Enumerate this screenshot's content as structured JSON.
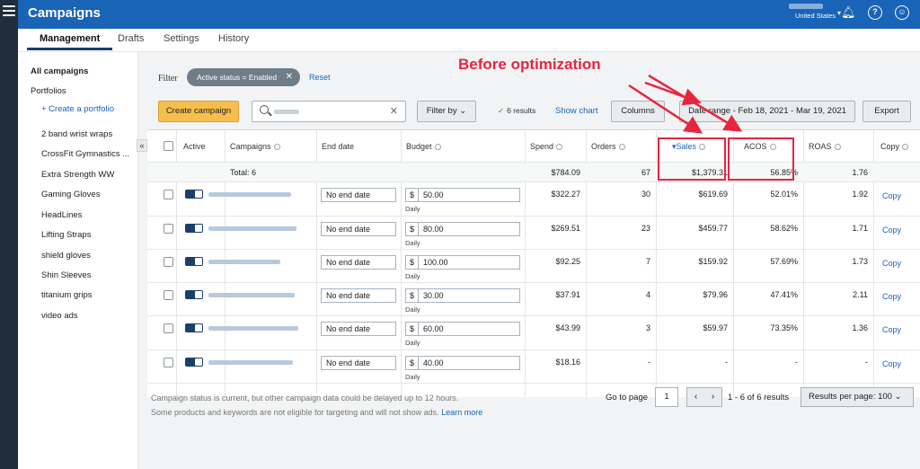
{
  "header": {
    "title": "Campaigns",
    "country": "United States",
    "bell_icon": "bell-icon",
    "help_icon": "help-icon",
    "user_icon": "user-icon"
  },
  "subnav": [
    "Management",
    "Drafts",
    "Settings",
    "History"
  ],
  "sidebar": {
    "all_campaigns": "All campaigns",
    "portfolios": "Portfolios",
    "create_portfolio": "+ Create a portfolio",
    "items": [
      "2 band wrist wraps",
      "CrossFit Gymnastics ...",
      "Extra Strength WW",
      "Gaming Gloves",
      "HeadLines",
      "Lifting Straps",
      "shield gloves",
      "Shin Sleeves",
      "titanium grips",
      "video ads"
    ]
  },
  "filter": {
    "label": "Filter",
    "chip": "Active status = Enabled",
    "reset": "Reset"
  },
  "annotation": "Before optimization",
  "toolbar": {
    "create": "Create campaign",
    "filter_by": "Filter by",
    "results": "6 results",
    "show_chart": "Show chart",
    "columns": "Columns",
    "date_range": "Date range - Feb 18, 2021 - Mar 19, 2021",
    "export": "Export"
  },
  "table": {
    "headers": {
      "active": "Active",
      "campaigns": "Campaigns",
      "end_date": "End date",
      "budget": "Budget",
      "spend": "Spend",
      "orders": "Orders",
      "sales": "Sales",
      "acos": "ACOS",
      "roas": "ROAS",
      "copy": "Copy"
    },
    "total": {
      "label": "Total: 6",
      "spend": "$784.09",
      "orders": "67",
      "sales": "$1,379.31",
      "acos": "56.85%",
      "roas": "1.76"
    },
    "rows": [
      {
        "end_date": "No end date",
        "budget": "50.00",
        "daily": "Daily",
        "spend": "$322.27",
        "orders": "30",
        "sales": "$619.69",
        "acos": "52.01%",
        "roas": "1.92",
        "copy": "Copy"
      },
      {
        "end_date": "No end date",
        "budget": "80.00",
        "daily": "Daily",
        "spend": "$269.51",
        "orders": "23",
        "sales": "$459.77",
        "acos": "58.62%",
        "roas": "1.71",
        "copy": "Copy"
      },
      {
        "end_date": "No end date",
        "budget": "100.00",
        "daily": "Daily",
        "spend": "$92.25",
        "orders": "7",
        "sales": "$159.92",
        "acos": "57.69%",
        "roas": "1.73",
        "copy": "Copy"
      },
      {
        "end_date": "No end date",
        "budget": "30.00",
        "daily": "Daily",
        "spend": "$37.91",
        "orders": "4",
        "sales": "$79.96",
        "acos": "47.41%",
        "roas": "2.11",
        "copy": "Copy"
      },
      {
        "end_date": "No end date",
        "budget": "60.00",
        "daily": "Daily",
        "spend": "$43.99",
        "orders": "3",
        "sales": "$59.97",
        "acos": "73.35%",
        "roas": "1.36",
        "copy": "Copy"
      },
      {
        "end_date": "No end date",
        "budget": "40.00",
        "daily": "Daily",
        "spend": "$18.16",
        "orders": "-",
        "sales": "-",
        "acos": "-",
        "roas": "-",
        "copy": "Copy"
      }
    ],
    "currency": "$"
  },
  "footer": {
    "note1": "Campaign status is current, but other campaign data could be delayed up to 12 hours.",
    "note2": "Some products and keywords are not eligible for targeting and will not show ads.",
    "learn_more": "Learn more",
    "go_to_page": "Go to page",
    "page": "1",
    "range": "1 - 6 of 6 results",
    "per_page": "Results per page: 100"
  },
  "colors": {
    "header_blue": "#1a64b7",
    "annotation_red": "#e8253f",
    "create_button": "#f6bf4d"
  }
}
